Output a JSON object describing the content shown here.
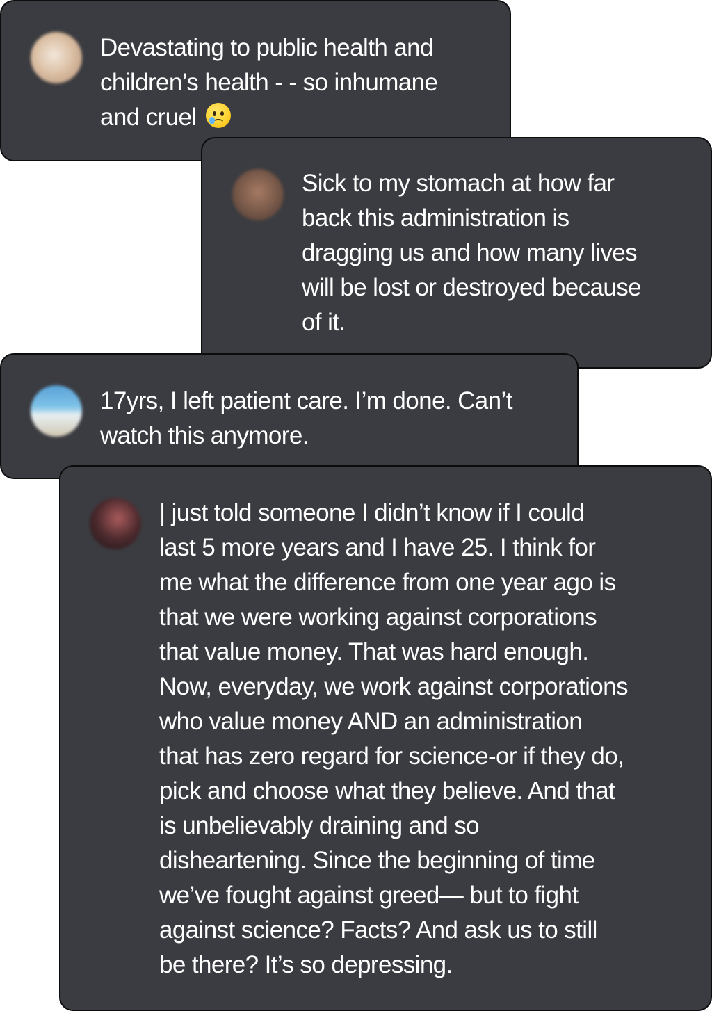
{
  "comments": [
    {
      "text": "Devastating to public health and\nchildren’s health - - so inhumane\nand cruel",
      "emoji": "smiling-face-with-tear"
    },
    {
      "text": "Sick to my stomach at how far\nback this administration is\ndragging us and how many lives\nwill be lost or destroyed because\nof it."
    },
    {
      "text": "17yrs, I left patient care. I’m done. Can’t\nwatch this anymore."
    },
    {
      "text": "| just told someone I didn’t know if I could\nlast 5 more years and I have 25. I think for\nme what the difference from one year ago is\nthat we were working against corporations\nthat value money. That was hard enough.\nNow, everyday, we work against corporations\nwho value money AND an administration\nthat has zero regard for science-or if they do,\npick and choose what they believe. And that\nis unbelievably draining and so\ndisheartening. Since the beginning of time\nwe’ve fought against greed— but to fight\nagainst science? Facts? And ask us to still\nbe there? It’s so depressing."
    }
  ]
}
